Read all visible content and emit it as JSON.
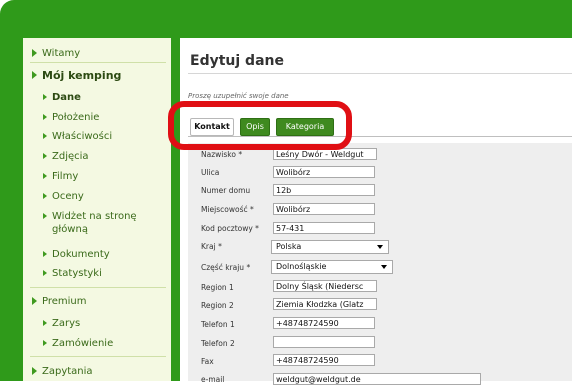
{
  "sidebar": {
    "items": [
      {
        "label": "Witamy"
      },
      {
        "label": "Mój kemping"
      },
      {
        "label": "Dane"
      },
      {
        "label": "Położenie"
      },
      {
        "label": "Właściwości"
      },
      {
        "label": "Zdjęcia"
      },
      {
        "label": "Filmy"
      },
      {
        "label": "Oceny"
      },
      {
        "label": "Widżet na stronę główną"
      },
      {
        "label": "Dokumenty"
      },
      {
        "label": "Statystyki"
      },
      {
        "label": "Premium"
      },
      {
        "label": "Zarys"
      },
      {
        "label": "Zamówienie"
      },
      {
        "label": "Zapytania"
      }
    ]
  },
  "main": {
    "title": "Edytuj dane",
    "hint": "Proszę uzupełnić swoje dane",
    "tabs": [
      {
        "label": "Kontakt",
        "active": true
      },
      {
        "label": "Opis",
        "active": false
      },
      {
        "label": "Kategoria",
        "active": false
      }
    ]
  },
  "form": {
    "fields": [
      {
        "label": "Nazwisko *",
        "value": "Leśny Dwór - Weldgut"
      },
      {
        "label": "Ulica",
        "value": "Wolibórz"
      },
      {
        "label": "Numer domu",
        "value": "12b"
      },
      {
        "label": "Miejscowość *",
        "value": "Wolibórz"
      },
      {
        "label": "Kod pocztowy *",
        "value": "57-431"
      },
      {
        "label": "Kraj *",
        "value": "Polska"
      },
      {
        "label": "Część kraju *",
        "value": "Dolnośląskie"
      },
      {
        "label": "Region 1",
        "value": "Dolny Śląsk (Niedersc"
      },
      {
        "label": "Region 2",
        "value": "Ziemia Kłodzka (Glatz"
      },
      {
        "label": "Telefon 1",
        "value": "+48748724590"
      },
      {
        "label": "Telefon 2",
        "value": ""
      },
      {
        "label": "Fax",
        "value": "+48748724590"
      },
      {
        "label": "e-mail",
        "value": "weldgut@weldgut.de"
      }
    ]
  },
  "colors": {
    "frame_green": "#2f9a1a",
    "highlight_red": "#e00f14",
    "tab_green": "#3f8a1f",
    "sidebar_bg": "#f4f9e2"
  }
}
